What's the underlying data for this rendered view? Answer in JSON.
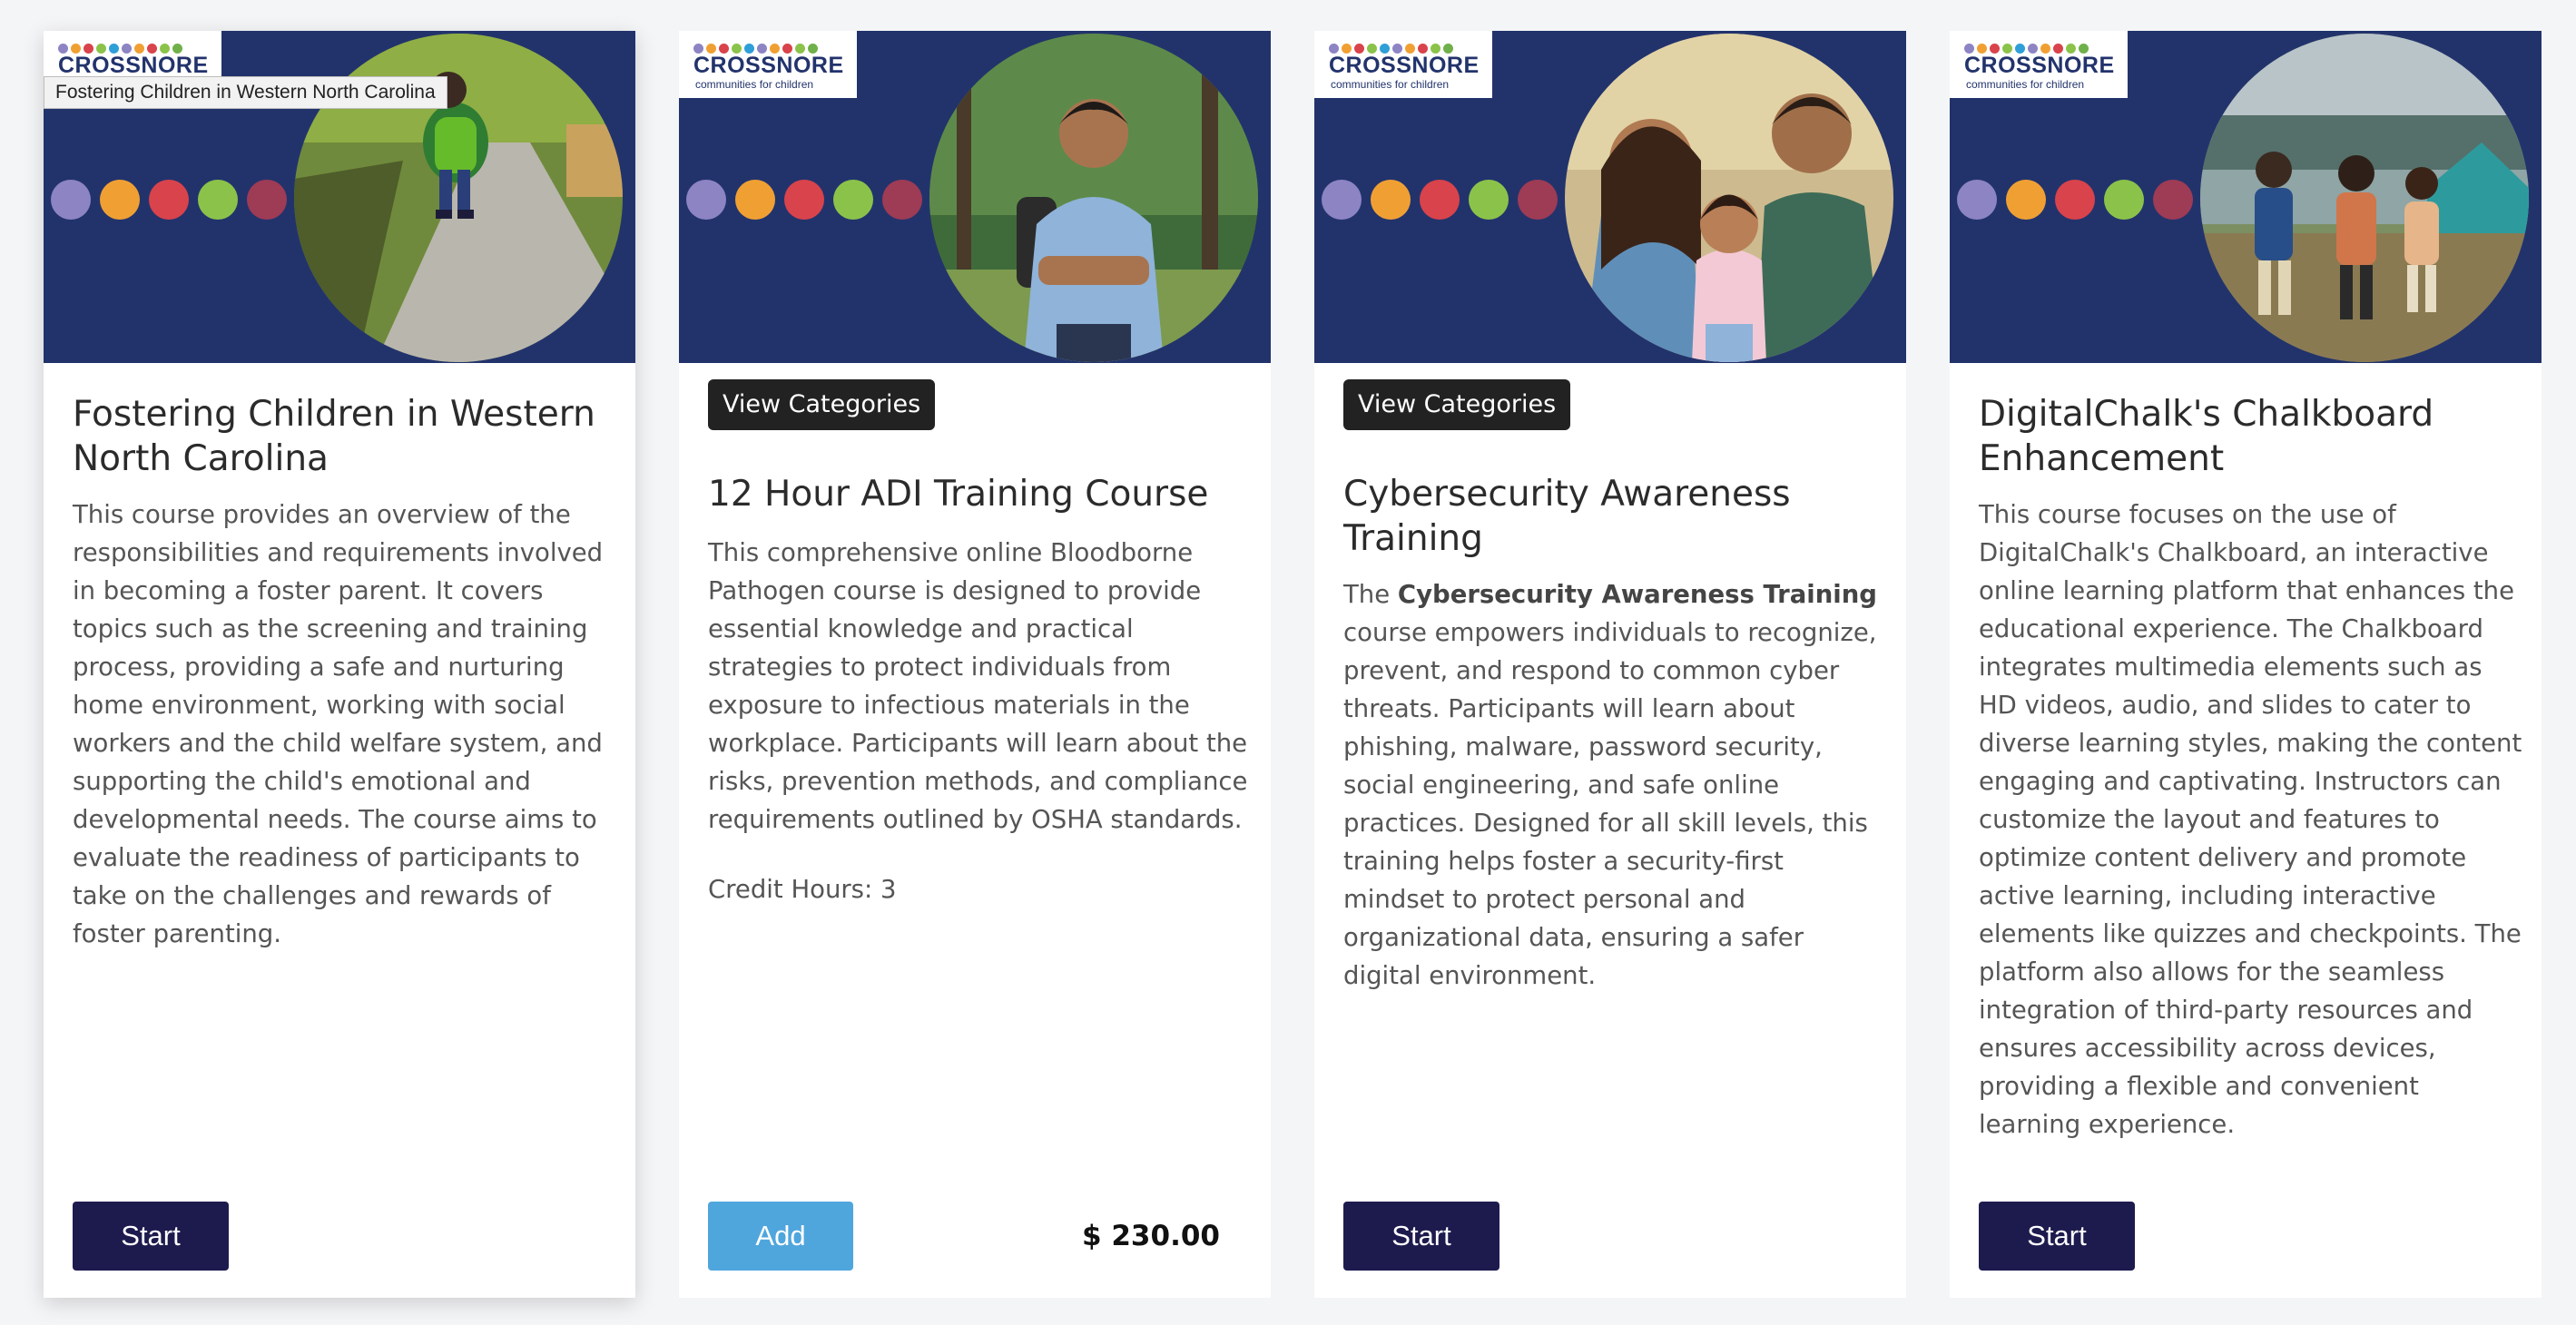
{
  "brand": {
    "name": "CROSSNORE",
    "tagline": "communities for children",
    "logo_dot_colors": [
      "#8d84c4",
      "#f0a033",
      "#d9434b",
      "#8bc34a",
      "#2f9fd8",
      "#8d84c4",
      "#f0a033",
      "#d9434b",
      "#8bc34a",
      "#6fb04a"
    ],
    "banner_dot_colors": [
      "#8d84c4",
      "#f0a033",
      "#d9434b",
      "#8bc34a",
      "#9e3b55"
    ],
    "banner_color": "#22336c"
  },
  "cards": [
    {
      "tooltip": "Fostering Children in Western North Carolina",
      "title": "Fostering Children in Western North Carolina",
      "description": "This course provides an overview of the responsibilities and requirements involved in becoming a foster parent. It covers topics such as the screening and training process, providing a safe and nurturing home environment, working with social workers and the child welfare system, and supporting the child's emotional and developmental needs. The course aims to evaluate the readiness of participants to take on the challenges and rewards of foster parenting.",
      "button": "Start"
    },
    {
      "category_label": "View Categories",
      "title": "12 Hour ADI Training Course",
      "description": "This comprehensive online Bloodborne Pathogen course is designed to provide essential knowledge and practical strategies to protect individuals from exposure to infectious materials in the workplace. Participants will learn about the risks, prevention methods, and compliance requirements outlined by OSHA standards.",
      "credit_hours": "Credit Hours: 3",
      "button": "Add",
      "price": "$ 230.00"
    },
    {
      "category_label": "View Categories",
      "title": "Cybersecurity Awareness Training",
      "description_prefix": "The",
      "description_bold": "Cybersecurity Awareness Training",
      "description": "course empowers individuals to recognize, prevent, and respond to common cyber threats. Participants will learn about phishing, malware, password security, social engineering, and safe online practices. Designed for all skill levels, this training helps foster a security-first mindset to protect personal and organizational data, ensuring a safer digital environment.",
      "button": "Start"
    },
    {
      "title": "DigitalChalk's Chalkboard Enhancement",
      "description": "This course focuses on the use of DigitalChalk's Chalkboard, an interactive online learning platform that enhances the educational experience. The Chalkboard integrates multimedia elements such as HD videos, audio, and slides to cater to diverse learning styles, making the content engaging and captivating. Instructors can customize the layout and features to optimize content delivery and promote active learning, including interactive elements like quizzes and checkpoints. The platform also allows for the seamless integration of third-party resources and ensures accessibility across devices, providing a flexible and convenient learning experience.",
      "button": "Start"
    }
  ]
}
